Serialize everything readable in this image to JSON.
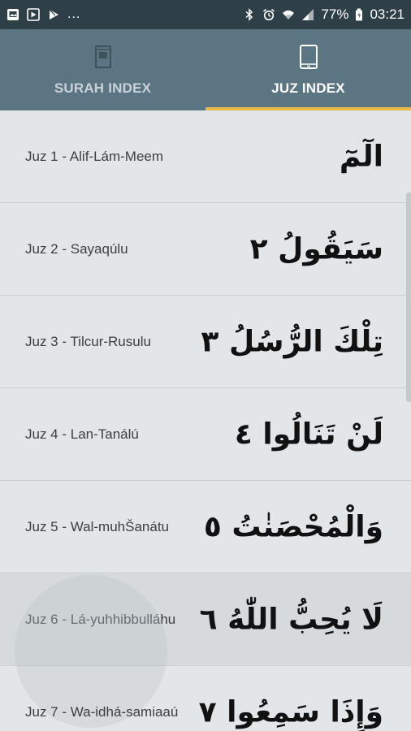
{
  "status_bar": {
    "left_icons": [
      "photo-icon",
      "play-store-icon",
      "play-store-icon"
    ],
    "overflow": "...",
    "right_icons": [
      "bluetooth-icon",
      "alarm-icon",
      "wifi-icon",
      "signal-icon"
    ],
    "battery": "77%",
    "battery_icon": "battery-icon",
    "time": "03:21"
  },
  "tabs": [
    {
      "label": "SURAH INDEX",
      "icon": "book-open-icon",
      "active": false
    },
    {
      "label": "JUZ INDEX",
      "icon": "tablet-icon",
      "active": true
    }
  ],
  "colors": {
    "status_bar": "#2f3f48",
    "tab_bar": "#5c7583",
    "tab_indicator": "#e8b84a",
    "list_background": "#e3e6e8",
    "text": "#3a3f42"
  },
  "juz_list": [
    {
      "label": "Juz 1 - Alif-Lám-Meem",
      "arabic": "الٓمٓ"
    },
    {
      "label": "Juz 2 - Sayaqúlu",
      "arabic": "سَيَقُولُ ٢"
    },
    {
      "label": "Juz 3 - Tilcur-Rusulu",
      "arabic": "تِلْكَ الرُّسُلُ ٣"
    },
    {
      "label": "Juz 4 - Lan-Tanálú",
      "arabic": "لَنْ تَنَالُوا ٤"
    },
    {
      "label": "Juz 5 - Wal-muhŠanátu",
      "arabic": "وَالْمُحْصَنٰتُ ٥"
    },
    {
      "label": "Juz 6 - Lá-yuhhibbulláhu",
      "arabic": "لَا يُحِبُّ اللّٰهُ ٦"
    },
    {
      "label": "Juz 7 - Wa-idhá-samiaaú",
      "arabic": "وَإِذَا سَمِعُوا ٧"
    }
  ]
}
